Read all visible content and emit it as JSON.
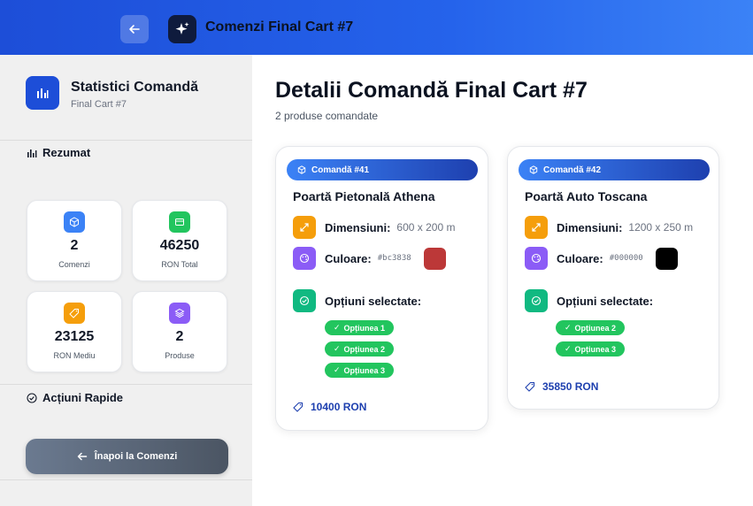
{
  "header": {
    "title": "Comenzi Final Cart #7",
    "back_icon": "arrow-left-icon",
    "brand_icon": "sparkles-icon"
  },
  "sidebar": {
    "title": "Statistici Comandă",
    "subtitle": "Final Cart #7",
    "summary_label": "Rezumat",
    "stats": [
      {
        "value": "2",
        "label": "Comenzi",
        "icon": "cube-icon",
        "color": "#3b82f6"
      },
      {
        "value": "46250",
        "label": "RON Total",
        "icon": "credit-card-icon",
        "color": "#22c55e"
      },
      {
        "value": "23125",
        "label": "RON Mediu",
        "icon": "tag-icon",
        "color": "#f59e0b"
      },
      {
        "value": "2",
        "label": "Produse",
        "icon": "layers-icon",
        "color": "#8b5cf6"
      }
    ],
    "quick_actions_label": "Acțiuni Rapide",
    "back_button_label": "Înapoi la Comenzi"
  },
  "main": {
    "title": "Detalii Comandă Final Cart #7",
    "subtitle": "2 produse comandate",
    "dimensions_label": "Dimensiuni:",
    "color_label": "Culoare:",
    "options_label": "Opțiuni selectate:",
    "orders": [
      {
        "badge": "Comandă #41",
        "name": "Poartă Pietonală Athena",
        "dimensions": "600 x 200 m",
        "color_code": "#bc3838",
        "color_hex": "#bc3838",
        "options": [
          "Opțiunea 1",
          "Opțiunea 2",
          "Opțiunea 3"
        ],
        "price": "10400 RON"
      },
      {
        "badge": "Comandă #42",
        "name": "Poartă Auto Toscana",
        "dimensions": "1200 x 250 m",
        "color_code": "#000000",
        "color_hex": "#000000",
        "options": [
          "Opțiunea 2",
          "Opțiunea 3"
        ],
        "price": "35850 RON"
      }
    ]
  },
  "colors": {
    "accent": "#2563eb",
    "dimensions_icon": "#f59e0b",
    "color_icon": "#8b5cf6",
    "options_icon": "#10b981",
    "option_pill": "#22c55e"
  }
}
